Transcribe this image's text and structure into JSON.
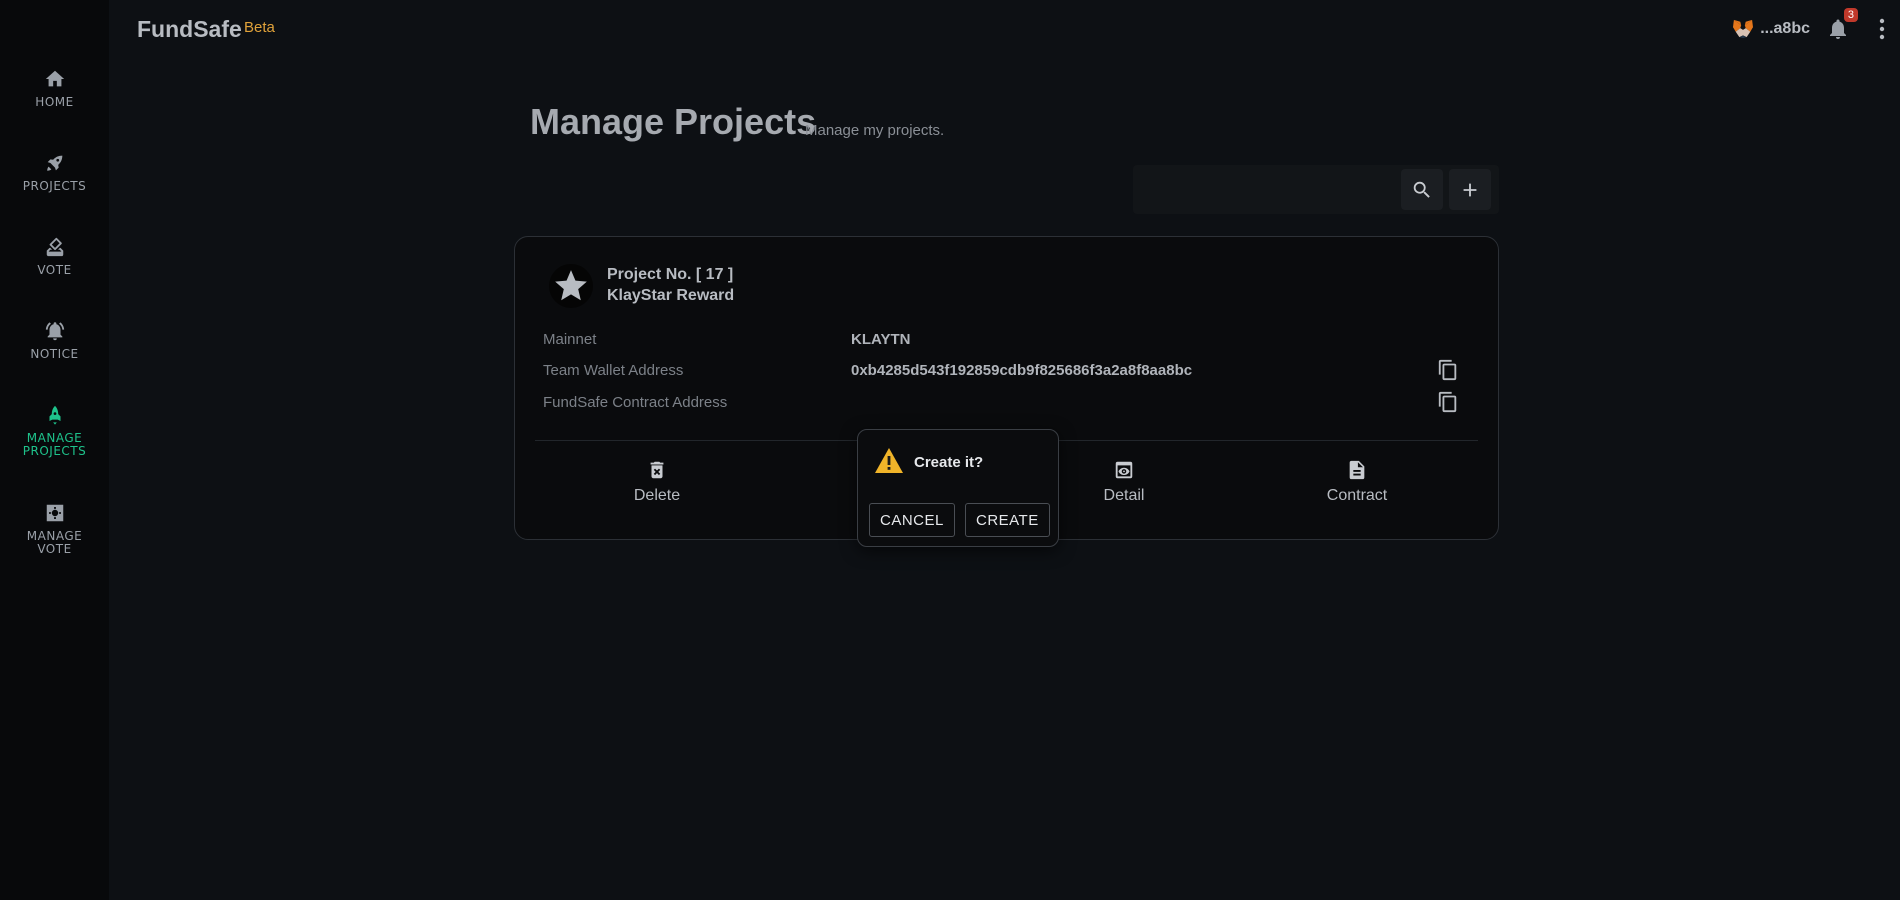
{
  "app": {
    "brand": "FundSafe",
    "badge": "Beta"
  },
  "sidebar": {
    "items": [
      {
        "label": "HOME",
        "icon": "home-icon"
      },
      {
        "label": "PROJECTS",
        "icon": "rocket-icon"
      },
      {
        "label": "VOTE",
        "icon": "ballot-icon"
      },
      {
        "label": "NOTICE",
        "icon": "alarm-icon"
      },
      {
        "label": "MANAGE PROJECTS",
        "icon": "rocket-icon",
        "active": true
      },
      {
        "label": "MANAGE VOTE",
        "icon": "gear-box-icon"
      }
    ]
  },
  "header": {
    "wallet_short": "...a8bc",
    "notification_count": "3"
  },
  "page": {
    "title": "Manage Projects",
    "subtitle": "Manage my projects."
  },
  "project": {
    "number": "Project No. [ 17 ]",
    "name": "KlayStar Reward",
    "fields": [
      {
        "label": "Mainnet",
        "value": "KLAYTN"
      },
      {
        "label": "Team Wallet Address",
        "value": "0xb4285d543f192859cdb9f825686f3a2a8f8aa8bc"
      },
      {
        "label": "FundSafe Contract Address",
        "value": ""
      }
    ],
    "actions": [
      {
        "label": "Delete",
        "icon": "delete-icon"
      },
      {
        "label": "Detail",
        "icon": "eye-icon"
      },
      {
        "label": "Contract",
        "icon": "document-icon"
      }
    ]
  },
  "dialog": {
    "message": "Create it?",
    "cancel_label": "CANCEL",
    "create_label": "CREATE"
  },
  "colors": {
    "accent": "#1ec28b",
    "beta": "#e0a23a",
    "warning": "#f0b429",
    "badge": "#c0392b"
  }
}
